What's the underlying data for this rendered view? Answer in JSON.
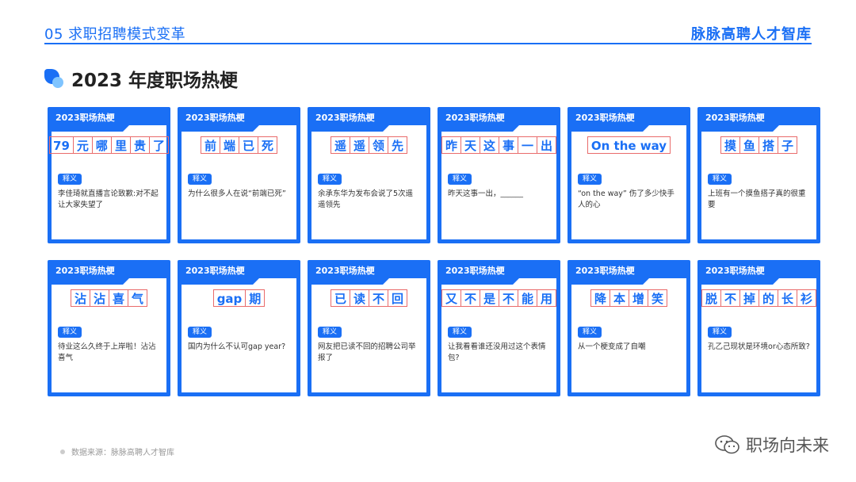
{
  "header": {
    "section": "05 求职招聘模式变革",
    "brand": "脉脉高聘人才智库"
  },
  "title": "2023 年度职场热梗",
  "card_label": "2023职场热梗",
  "tag_label": "释义",
  "cards": [
    {
      "meme": [
        "79",
        "元",
        "哪",
        "里",
        "贵",
        "了"
      ],
      "desc": "李佳琦就直播言论致歉:对不起让大家失望了"
    },
    {
      "meme": [
        "前",
        "端",
        "已",
        "死"
      ],
      "desc": "为什么很多人在说“前端已死”"
    },
    {
      "meme": [
        "遥",
        "遥",
        "领",
        "先"
      ],
      "desc": "余承东华为发布会说了5次遥遥领先"
    },
    {
      "meme": [
        "昨",
        "天",
        "这",
        "事",
        "一",
        "出"
      ],
      "desc": "昨天这事一出，______"
    },
    {
      "meme": [
        "On the way"
      ],
      "desc": "“on the way” 伤了多少快手人的心"
    },
    {
      "meme": [
        "摸",
        "鱼",
        "搭",
        "子"
      ],
      "desc": "上班有一个摸鱼搭子真的很重要"
    },
    {
      "meme": [
        "沾",
        "沾",
        "喜",
        "气"
      ],
      "desc": "待业这么久终于上岸啦！沾沾喜气"
    },
    {
      "meme": [
        "gap",
        "期"
      ],
      "desc": "国内为什么不认可gap year?"
    },
    {
      "meme": [
        "已",
        "读",
        "不",
        "回"
      ],
      "desc": "网友把已读不回的招聘公司举报了"
    },
    {
      "meme": [
        "又",
        "不",
        "是",
        "不",
        "能",
        "用"
      ],
      "desc": "让我看看谁还没用过这个表情包?"
    },
    {
      "meme": [
        "降",
        "本",
        "增",
        "笑"
      ],
      "desc": "从一个梗变成了自嘲"
    },
    {
      "meme": [
        "脱",
        "不",
        "掉",
        "的",
        "长",
        "衫"
      ],
      "desc": "孔乙己现状是环境or心态所致?"
    }
  ],
  "source": "数据来源：脉脉高聘人才智库",
  "watermark": "职场向未来",
  "colors": {
    "accent": "#1a6ff5",
    "box_border": "#e96b6b"
  }
}
